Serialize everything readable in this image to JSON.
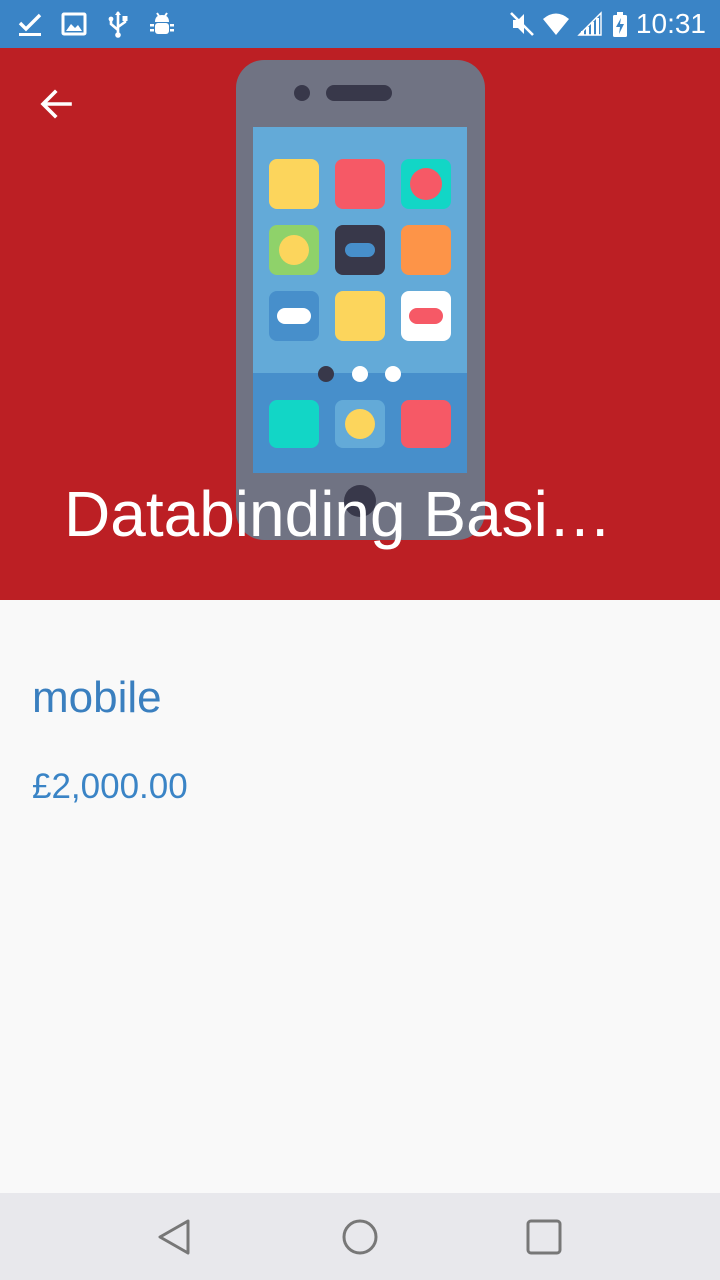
{
  "status_bar": {
    "time": "10:31",
    "left_icons": [
      "check-icon",
      "image-icon",
      "usb-icon",
      "android-debug-icon"
    ],
    "right_icons": [
      "mute-icon",
      "wifi-icon",
      "signal-icon",
      "battery-charging-icon"
    ]
  },
  "header": {
    "title": "Databinding Basi…",
    "background_color": "#bc1f24",
    "back_icon": "arrow-back-icon",
    "hero_image": "smartphone-illustration"
  },
  "product": {
    "name": "mobile",
    "price": "£2,000.00",
    "text_color": "#3a7fbf"
  },
  "nav_bar": {
    "buttons": [
      "back-triangle-icon",
      "home-circle-icon",
      "recents-square-icon"
    ]
  },
  "colors": {
    "status_bar": "#3a84c6",
    "page_background": "#f9f9f9",
    "nav_bar": "#e8e8ec"
  }
}
